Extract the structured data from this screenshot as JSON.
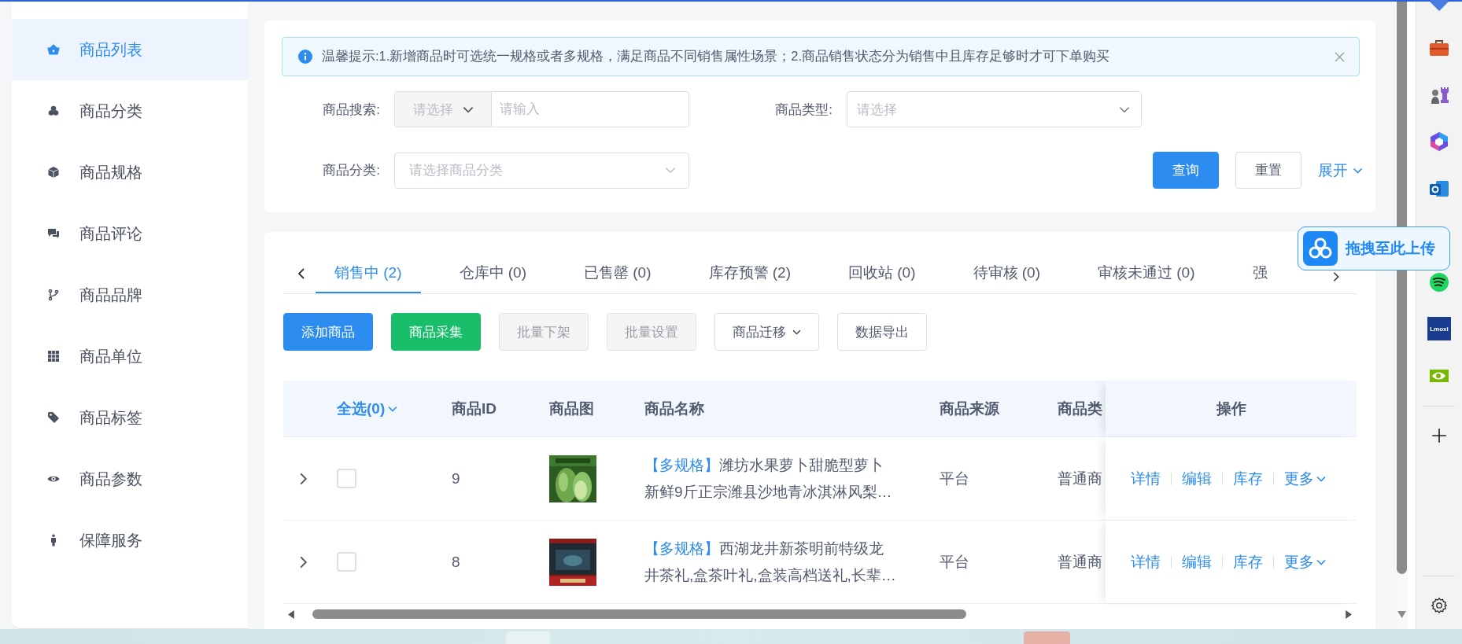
{
  "sidebar": {
    "items": [
      {
        "label": "商品列表",
        "selected": true
      },
      {
        "label": "商品分类",
        "selected": false
      },
      {
        "label": "商品规格",
        "selected": false
      },
      {
        "label": "商品评论",
        "selected": false
      },
      {
        "label": "商品品牌",
        "selected": false
      },
      {
        "label": "商品单位",
        "selected": false
      },
      {
        "label": "商品标签",
        "selected": false
      },
      {
        "label": "商品参数",
        "selected": false
      },
      {
        "label": "保障服务",
        "selected": false
      }
    ]
  },
  "notice": {
    "text": "温馨提示:1.新增商品时可选统一规格或者多规格，满足商品不同销售属性场景；2.商品销售状态分为销售中且库存足够时才可下单购买"
  },
  "filters": [
    {
      "kind": "search",
      "label": "商品搜索:",
      "select_placeholder": "请选择",
      "placeholder": "请输入"
    },
    {
      "kind": "select",
      "label": "商品类型:",
      "placeholder": "请选择"
    },
    {
      "kind": "select",
      "label": "商品分类:",
      "placeholder": "请选择商品分类"
    }
  ],
  "filter_buttons": {
    "query": "查询",
    "reset": "重置",
    "expand": "展开"
  },
  "tabs": [
    {
      "label": "销售中 (2)",
      "selected": true
    },
    {
      "label": "仓库中 (0)",
      "selected": false
    },
    {
      "label": "已售罄 (0)",
      "selected": false
    },
    {
      "label": "库存预警 (2)",
      "selected": false
    },
    {
      "label": "回收站 (0)",
      "selected": false
    },
    {
      "label": "待审核 (0)",
      "selected": false
    },
    {
      "label": "审核未通过 (0)",
      "selected": false
    },
    {
      "label": "强",
      "selected": false
    }
  ],
  "actions": [
    {
      "label": "添加商品",
      "kind": "primary",
      "disabled": false,
      "dropdown": false
    },
    {
      "label": "商品采集",
      "kind": "success",
      "disabled": false,
      "dropdown": false
    },
    {
      "label": "批量下架",
      "kind": "default",
      "disabled": true,
      "dropdown": false
    },
    {
      "label": "批量设置",
      "kind": "default",
      "disabled": true,
      "dropdown": false
    },
    {
      "label": "商品迁移",
      "kind": "default",
      "disabled": false,
      "dropdown": true
    },
    {
      "label": "数据导出",
      "kind": "default",
      "disabled": false,
      "dropdown": false
    }
  ],
  "table": {
    "select_all": "全选(0)",
    "columns": [
      "商品ID",
      "商品图",
      "商品名称",
      "商品来源",
      "商品类",
      "操作"
    ],
    "rows": [
      {
        "expanded": false,
        "checked": false,
        "id": "9",
        "tag": "【多规格】",
        "name_lines": [
          "潍坊水果萝卜甜脆型萝卜",
          "新鲜9斤正宗潍县沙地青冰淇淋风梨…"
        ],
        "source": "平台",
        "type": "普通商",
        "links": [
          "详情",
          "编辑",
          "库存",
          "更多"
        ]
      },
      {
        "expanded": false,
        "checked": false,
        "id": "8",
        "tag": "【多规格】",
        "name_lines": [
          "西湖龙井新茶明前特级龙",
          "井茶礼,盒茶叶礼,盒装高档送礼,长辈…"
        ],
        "source": "平台",
        "type": "普通商",
        "links": [
          "详情",
          "编辑",
          "库存",
          "更多"
        ]
      }
    ]
  },
  "upload_button": {
    "label": "拖拽至此上传"
  },
  "edge_bar": {
    "logo_text": "Lmoxi"
  }
}
